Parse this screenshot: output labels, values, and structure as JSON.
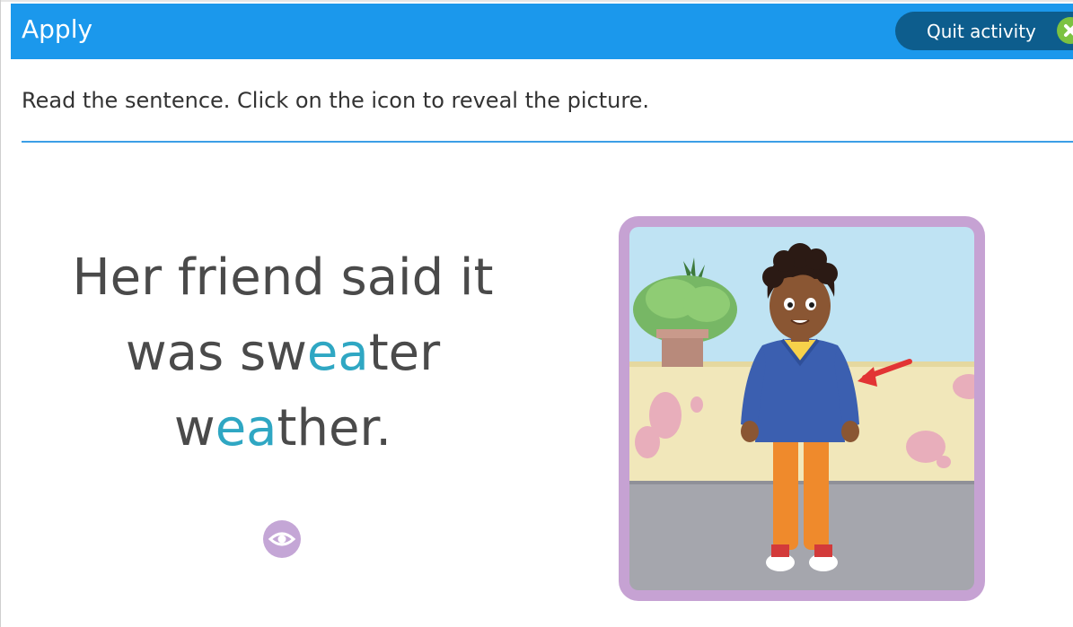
{
  "header": {
    "title": "Apply",
    "quit_label": "Quit activity",
    "quit_icon": "close-icon",
    "colors": {
      "bar": "#1b98ec",
      "quit_button": "#0d5d8d",
      "quit_icon": "#7cc241"
    }
  },
  "instruction": "Read the sentence. Click on the icon to reveal the picture.",
  "sentence": {
    "line1": "Her friend said it",
    "line2": [
      {
        "text": "was sw",
        "highlight": false
      },
      {
        "text": "ea",
        "highlight": true
      },
      {
        "text": "ter",
        "highlight": false
      }
    ],
    "line3": [
      {
        "text": "w",
        "highlight": false
      },
      {
        "text": "ea",
        "highlight": true
      },
      {
        "text": "ther.",
        "highlight": false
      }
    ],
    "colors": {
      "text": "#4a4a4a",
      "highlight": "#2fa7c3"
    }
  },
  "reveal_icon": "eye-icon",
  "picture": {
    "subject": "boy wearing a blue sweater with a red arrow pointing at it",
    "frame_color": "#c6a2d3"
  }
}
